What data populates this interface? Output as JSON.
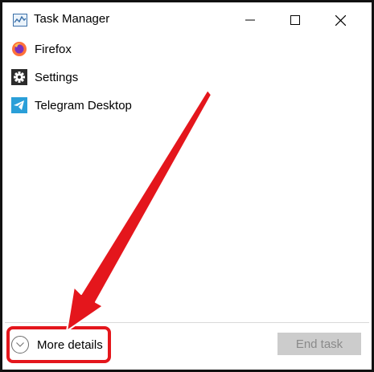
{
  "window": {
    "title": "Task Manager",
    "controls": [
      "minimize",
      "maximize",
      "close"
    ]
  },
  "processes": [
    {
      "name": "Firefox",
      "icon": "firefox-icon"
    },
    {
      "name": "Settings",
      "icon": "gear-icon"
    },
    {
      "name": "Telegram Desktop",
      "icon": "telegram-icon"
    }
  ],
  "footer": {
    "more_details_label": "More details",
    "end_task_label": "End task"
  },
  "colors": {
    "annotation_red": "#e4161c",
    "disabled_button": "#cccccc"
  }
}
